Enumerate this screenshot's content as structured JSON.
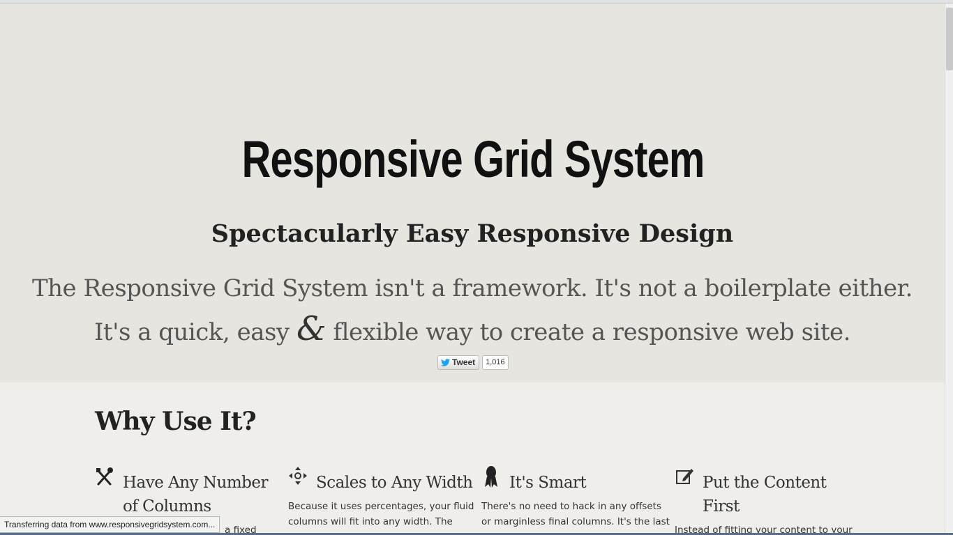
{
  "hero": {
    "title": "Responsive Grid System",
    "subtitle": "Spectacularly Easy Responsive Design",
    "lead_line1": "The Responsive Grid System isn't a framework. It's not a boilerplate either.",
    "lead_line2_a": "It's a quick, easy",
    "lead_amp": "&",
    "lead_line2_b": "flexible way to create a responsive web site.",
    "tweet_label": "Tweet",
    "tweet_count": "1,016"
  },
  "why": {
    "title": "Why Use It?",
    "features": [
      {
        "icon": "tools-icon",
        "title": "Have Any Number of Columns",
        "text": "a fixed"
      },
      {
        "icon": "move-arrows-icon",
        "title": "Scales to Any Width",
        "text": "Because it uses percentages, your fluid columns will fit into any width. The"
      },
      {
        "icon": "award-ribbon-icon",
        "title": "It's Smart",
        "text": "There's no need to hack in any offsets or marginless final columns. It's the last"
      },
      {
        "icon": "edit-pencil-icon",
        "title": "Put the Content First",
        "text": "Instead of fitting your content to your grid, you can make your grid suit your"
      }
    ]
  },
  "status_bar": {
    "text": "Transferring data from www.responsivegridsystem.com..."
  },
  "colors": {
    "hero_bg": "#e7e5e0",
    "body_bg": "#efeeea",
    "twitter_blue": "#1da1f2"
  }
}
